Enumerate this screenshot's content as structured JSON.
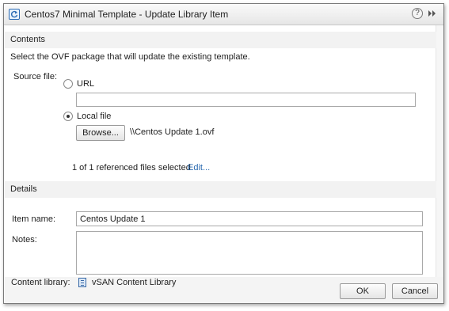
{
  "window": {
    "title": "Centos7 Minimal Template - Update Library Item",
    "help_glyph": "?"
  },
  "contents": {
    "header": "Contents",
    "description": "Select the OVF package that will update the existing template.",
    "source_file_label": "Source file:",
    "url_option": {
      "label": "URL",
      "selected": false,
      "value": ""
    },
    "local_option": {
      "label": "Local file",
      "selected": true
    },
    "browse_button": "Browse...",
    "selected_file": "\\\\Centos Update 1.ovf",
    "referenced_files": "1 of 1 referenced files selected",
    "edit_link": "Edit..."
  },
  "details": {
    "header": "Details",
    "item_name_label": "Item name:",
    "item_name_value": "Centos Update 1",
    "notes_label": "Notes:",
    "notes_value": ""
  },
  "footer": {
    "content_library_label": "Content library:",
    "content_library_value": "vSAN Content Library",
    "ok_button": "OK",
    "cancel_button": "Cancel"
  },
  "colors": {
    "link": "#2a6ab0",
    "section_header_bg": "#f2f2f2"
  }
}
